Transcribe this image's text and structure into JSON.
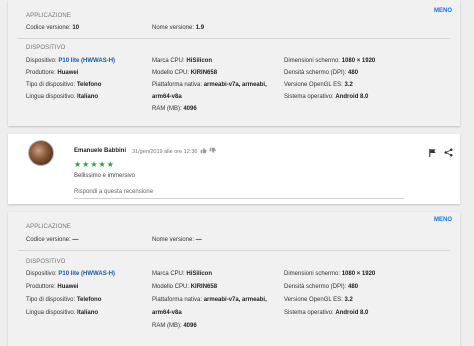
{
  "top_panel": {
    "less_label": "MENO",
    "app_section": "APPLICAZIONE",
    "version_code_label": "Codice versione:",
    "version_code_value": "10",
    "version_name_label": "Nome versione:",
    "version_name_value": "1.9",
    "device_section": "DISPOSITIVO",
    "device_label": "Dispositivo:",
    "device_value": "P10 lite (HWWAS-H)",
    "manufacturer_label": "Produttore:",
    "manufacturer_value": "Huawei",
    "type_label": "Tipo di dispositivo:",
    "type_value": "Telefono",
    "lang_label": "Lingua dispositivo:",
    "lang_value": "Italiano",
    "cpu_brand_label": "Marca CPU:",
    "cpu_brand_value": "HiSilicon",
    "cpu_model_label": "Modello CPU:",
    "cpu_model_value": "KIRIN658",
    "platform_label": "Piattaforma nativa:",
    "platform_value_1": "armeabi-v7a, armeabi,",
    "platform_value_2": "arm64-v8a",
    "ram_label": "RAM (MB):",
    "ram_value": "4096",
    "screen_dim_label": "Dimensioni schermo:",
    "screen_dim_value": "1080 × 1920",
    "density_label": "Densità schermo (DPI):",
    "density_value": "480",
    "opengl_label": "Versione OpenGL ES:",
    "opengl_value": "3.2",
    "os_label": "Sistema operativo:",
    "os_value": "Android 8.0"
  },
  "review": {
    "author": "Emanuele Babbini",
    "date": "31/gen/2019 alle ore 12:36",
    "stars": "★★★★★",
    "rating": 5,
    "text": "Bellissimo e immersivo",
    "reply_placeholder": "Rispondi a questa recensione",
    "icons": [
      "thumb-up-icon",
      "thumb-down-icon",
      "flag-icon",
      "share-icon"
    ]
  },
  "bottom_panel": {
    "less_label": "MENO",
    "app_section": "APPLICAZIONE",
    "version_code_label": "Codice versione:",
    "version_code_value": "—",
    "version_name_label": "Nome versione:",
    "version_name_value": "—",
    "device_section": "DISPOSITIVO",
    "device_label": "Dispositivo:",
    "device_value": "P10 lite (HWWAS-H)",
    "manufacturer_label": "Produttore:",
    "manufacturer_value": "Huawei",
    "type_label": "Tipo di dispositivo:",
    "type_value": "Telefono",
    "lang_label": "Lingua dispositivo:",
    "lang_value": "Italiano",
    "cpu_brand_label": "Marca CPU:",
    "cpu_brand_value": "HiSilicon",
    "cpu_model_label": "Modello CPU:",
    "cpu_model_value": "KIRIN658",
    "platform_label": "Piattaforma nativa:",
    "platform_value_1": "armeabi-v7a, armeabi,",
    "platform_value_2": "arm64-v8a",
    "ram_label": "RAM (MB):",
    "ram_value": "4096",
    "screen_dim_label": "Dimensioni schermo:",
    "screen_dim_value": "1080 × 1920",
    "density_label": "Densità schermo (DPI):",
    "density_value": "480",
    "opengl_label": "Versione OpenGL ES:",
    "opengl_value": "3.2",
    "os_label": "Sistema operativo:",
    "os_value": "Android 8.0"
  },
  "colors": {
    "link": "#1a56b0",
    "accent": "#1a73e8",
    "stars": "#2e9b4b"
  }
}
